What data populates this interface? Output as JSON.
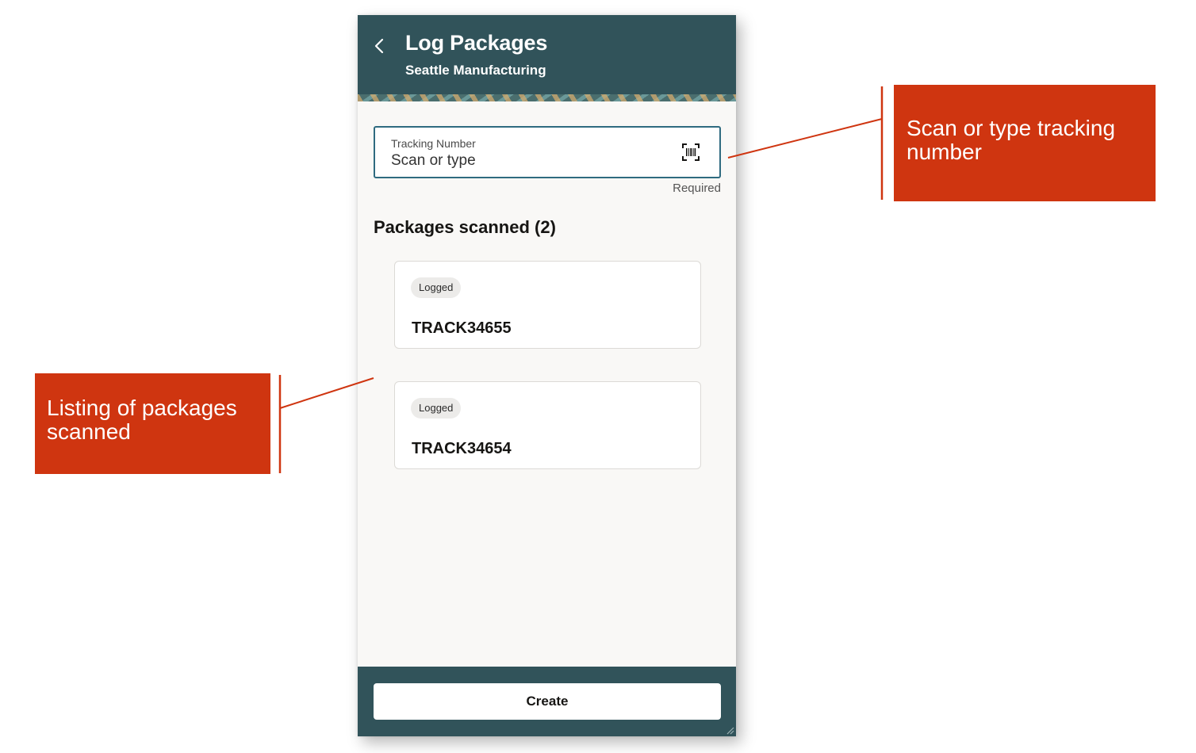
{
  "header": {
    "title": "Log Packages",
    "subtitle": "Seattle Manufacturing",
    "back_icon": "chevron-left-icon"
  },
  "tracking_field": {
    "label": "Tracking Number",
    "placeholder": "Scan or type",
    "scan_icon": "barcode-scan-icon",
    "helper_text": "Required"
  },
  "packages": {
    "section_title": "Packages scanned (2)",
    "items": [
      {
        "status": "Logged",
        "tracking_number": "TRACK34655"
      },
      {
        "status": "Logged",
        "tracking_number": "TRACK34654"
      }
    ]
  },
  "footer": {
    "create_label": "Create"
  },
  "annotations": {
    "tracking_callout": "Scan or type tracking number",
    "packages_callout": "Listing of packages scanned"
  },
  "colors": {
    "header_bg": "#31535a",
    "callout_bg": "#cf3510",
    "field_border": "#2f6b80",
    "page_bg": "#f9f8f6"
  }
}
